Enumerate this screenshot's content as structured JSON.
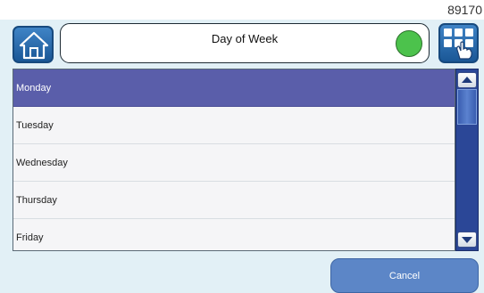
{
  "figure_id": "89170",
  "header": {
    "home_icon": "home-icon",
    "title": "Day of Week",
    "status_color": "#4cc24c",
    "apps_icon": "grid-touch-icon"
  },
  "list": {
    "items": [
      {
        "label": "Monday",
        "selected": true
      },
      {
        "label": "Tuesday",
        "selected": false
      },
      {
        "label": "Wednesday",
        "selected": false
      },
      {
        "label": "Thursday",
        "selected": false
      },
      {
        "label": "Friday",
        "selected": false
      }
    ]
  },
  "colors": {
    "selected_row": "#5a5eaa",
    "scrollbar": "#2b4797",
    "accent_button": "#5c86c7",
    "panel_background": "#e2f0f6"
  },
  "footer": {
    "cancel_label": "Cancel"
  }
}
